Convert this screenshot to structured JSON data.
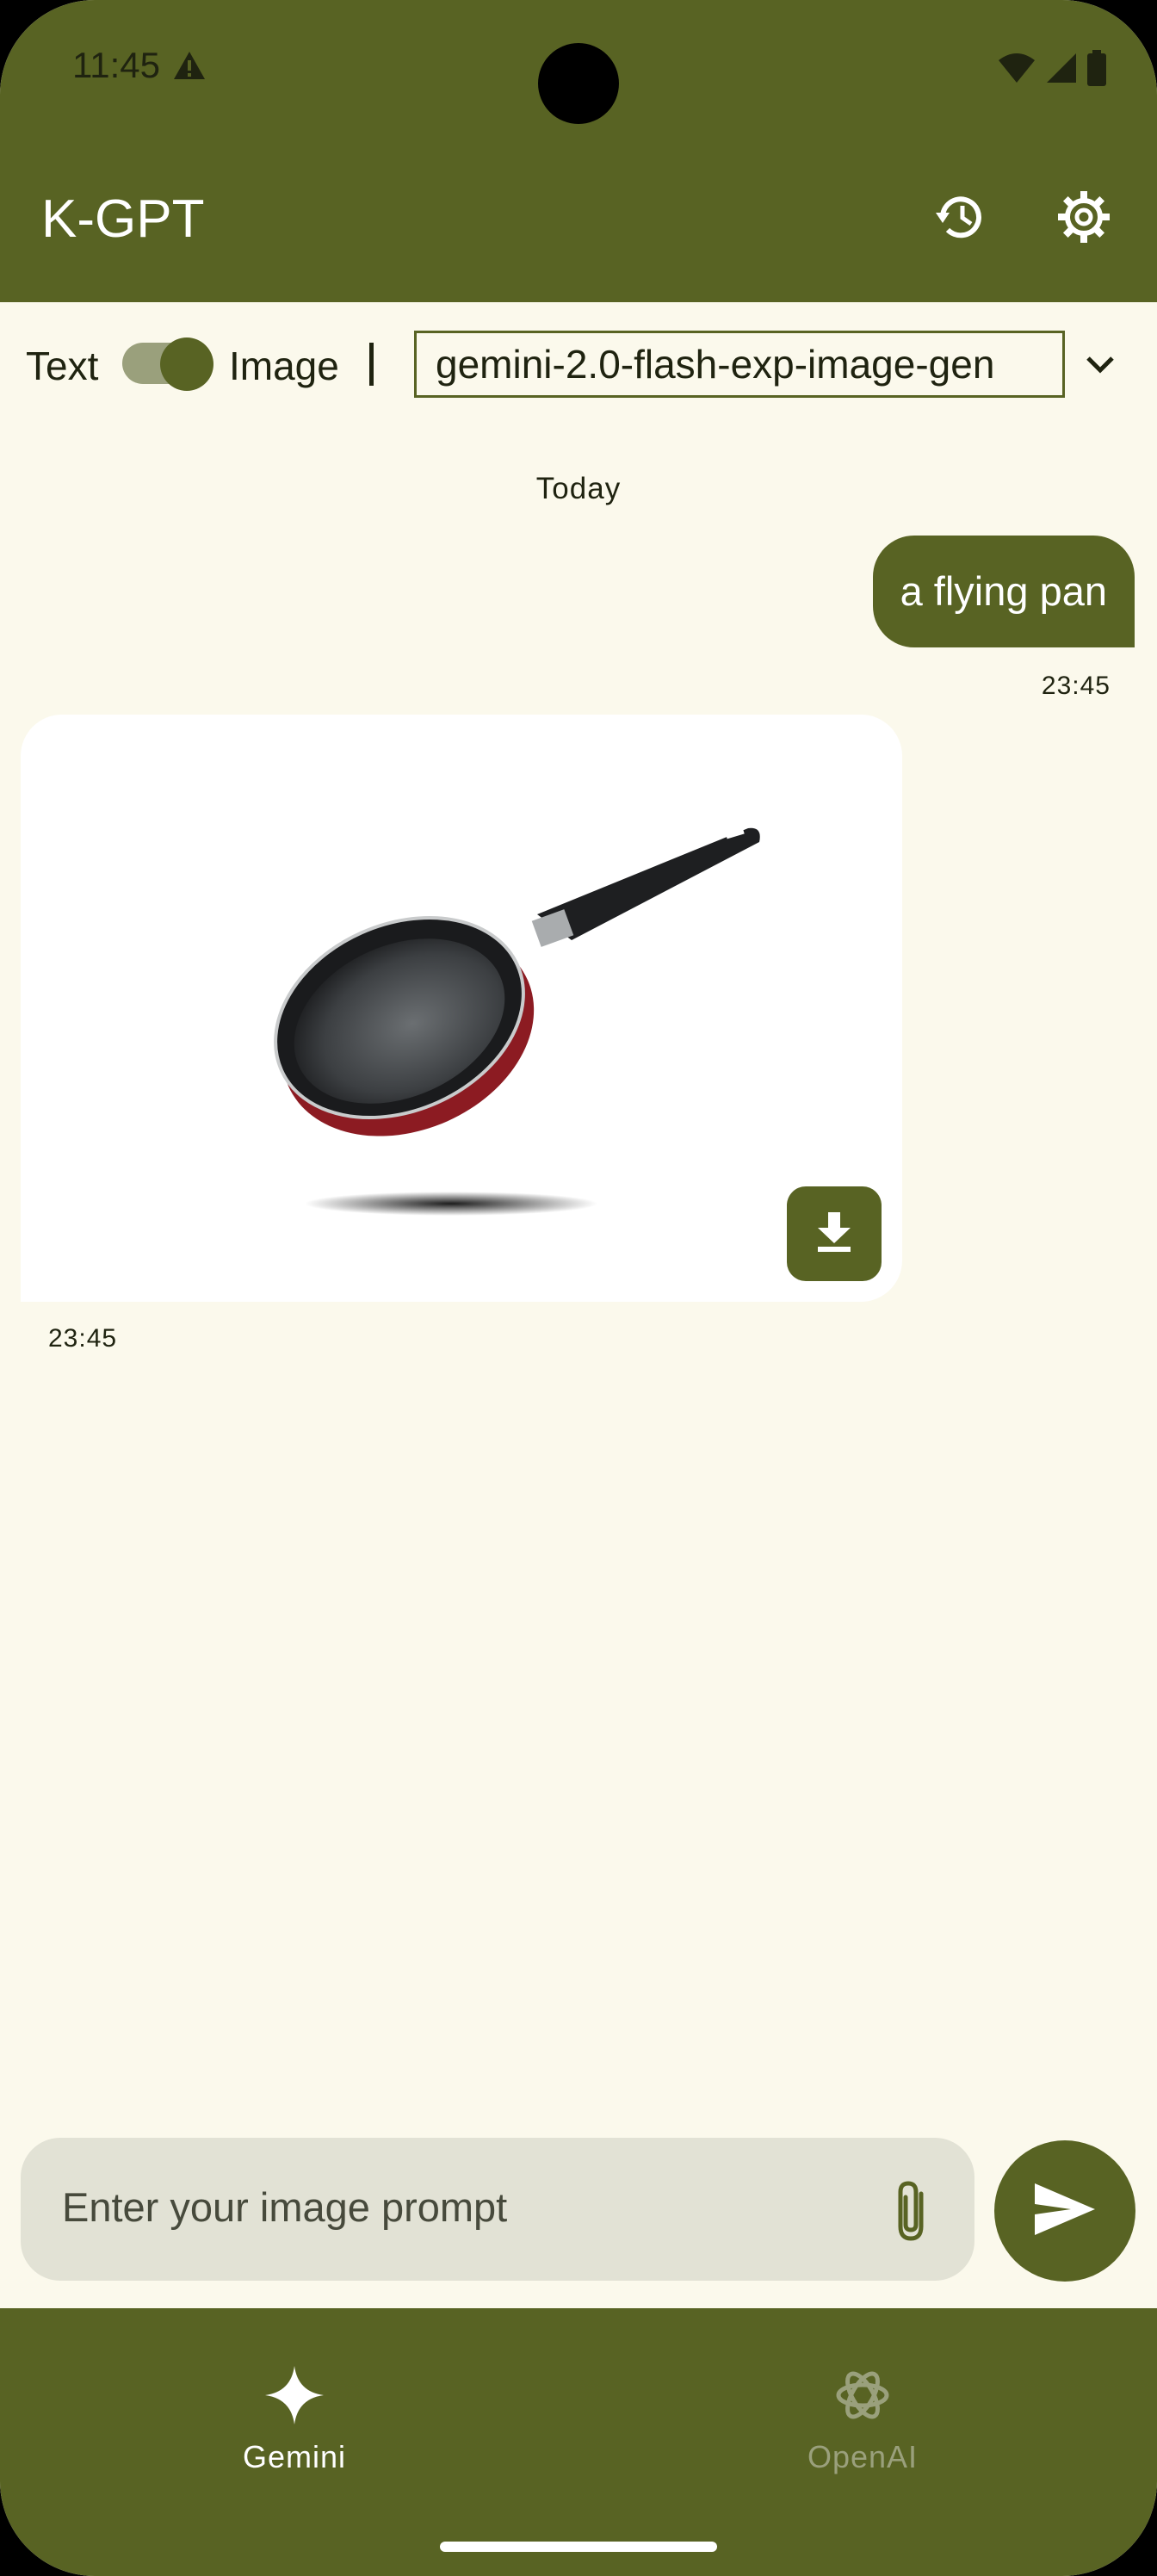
{
  "status_bar": {
    "time": "11:45",
    "warning_icon": "warning-icon",
    "wifi_icon": "wifi-icon",
    "signal_icon": "signal-icon",
    "battery_icon": "battery-icon"
  },
  "app_bar": {
    "title": "K-GPT",
    "history_icon": "history-icon",
    "settings_icon": "gear-icon"
  },
  "mode": {
    "text_label": "Text",
    "image_label": "Image",
    "separator": "|",
    "toggle_on": true,
    "model": "gemini-2.0-flash-exp-image-gen"
  },
  "chat": {
    "date_separator": "Today",
    "messages": [
      {
        "role": "user",
        "text": "a flying pan",
        "time": "23:45"
      },
      {
        "role": "assistant",
        "type": "image",
        "image": "frying-pan-image",
        "time": "23:45"
      }
    ]
  },
  "composer": {
    "placeholder": "Enter your image prompt",
    "attach_icon": "paperclip-icon",
    "send_icon": "send-icon"
  },
  "bottom_nav": {
    "items": [
      {
        "label": "Gemini",
        "icon": "sparkle-icon",
        "active": true
      },
      {
        "label": "OpenAI",
        "icon": "openai-icon",
        "active": false
      }
    ]
  },
  "colors": {
    "primary": "#586323",
    "background": "#fbf9ec",
    "field": "#e2e2d5",
    "inactive_nav": "#9aa07c"
  }
}
